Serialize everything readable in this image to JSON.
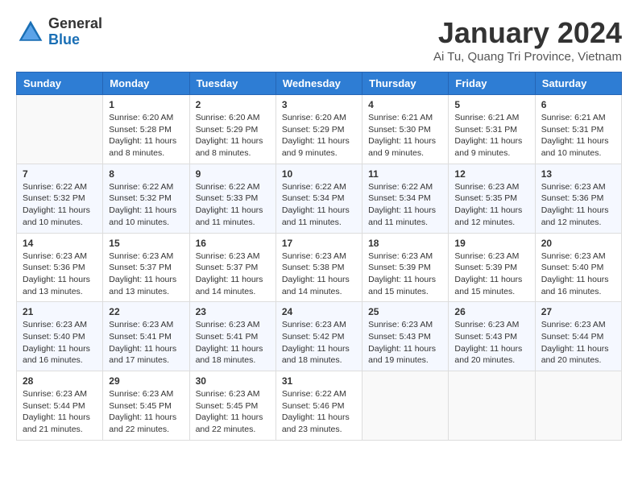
{
  "header": {
    "logo_general": "General",
    "logo_blue": "Blue",
    "month_title": "January 2024",
    "location": "Ai Tu, Quang Tri Province, Vietnam"
  },
  "calendar": {
    "days_of_week": [
      "Sunday",
      "Monday",
      "Tuesday",
      "Wednesday",
      "Thursday",
      "Friday",
      "Saturday"
    ],
    "weeks": [
      [
        {
          "day": "",
          "detail": ""
        },
        {
          "day": "1",
          "detail": "Sunrise: 6:20 AM\nSunset: 5:28 PM\nDaylight: 11 hours\nand 8 minutes."
        },
        {
          "day": "2",
          "detail": "Sunrise: 6:20 AM\nSunset: 5:29 PM\nDaylight: 11 hours\nand 8 minutes."
        },
        {
          "day": "3",
          "detail": "Sunrise: 6:20 AM\nSunset: 5:29 PM\nDaylight: 11 hours\nand 9 minutes."
        },
        {
          "day": "4",
          "detail": "Sunrise: 6:21 AM\nSunset: 5:30 PM\nDaylight: 11 hours\nand 9 minutes."
        },
        {
          "day": "5",
          "detail": "Sunrise: 6:21 AM\nSunset: 5:31 PM\nDaylight: 11 hours\nand 9 minutes."
        },
        {
          "day": "6",
          "detail": "Sunrise: 6:21 AM\nSunset: 5:31 PM\nDaylight: 11 hours\nand 10 minutes."
        }
      ],
      [
        {
          "day": "7",
          "detail": "Sunrise: 6:22 AM\nSunset: 5:32 PM\nDaylight: 11 hours\nand 10 minutes."
        },
        {
          "day": "8",
          "detail": "Sunrise: 6:22 AM\nSunset: 5:32 PM\nDaylight: 11 hours\nand 10 minutes."
        },
        {
          "day": "9",
          "detail": "Sunrise: 6:22 AM\nSunset: 5:33 PM\nDaylight: 11 hours\nand 11 minutes."
        },
        {
          "day": "10",
          "detail": "Sunrise: 6:22 AM\nSunset: 5:34 PM\nDaylight: 11 hours\nand 11 minutes."
        },
        {
          "day": "11",
          "detail": "Sunrise: 6:22 AM\nSunset: 5:34 PM\nDaylight: 11 hours\nand 11 minutes."
        },
        {
          "day": "12",
          "detail": "Sunrise: 6:23 AM\nSunset: 5:35 PM\nDaylight: 11 hours\nand 12 minutes."
        },
        {
          "day": "13",
          "detail": "Sunrise: 6:23 AM\nSunset: 5:36 PM\nDaylight: 11 hours\nand 12 minutes."
        }
      ],
      [
        {
          "day": "14",
          "detail": "Sunrise: 6:23 AM\nSunset: 5:36 PM\nDaylight: 11 hours\nand 13 minutes."
        },
        {
          "day": "15",
          "detail": "Sunrise: 6:23 AM\nSunset: 5:37 PM\nDaylight: 11 hours\nand 13 minutes."
        },
        {
          "day": "16",
          "detail": "Sunrise: 6:23 AM\nSunset: 5:37 PM\nDaylight: 11 hours\nand 14 minutes."
        },
        {
          "day": "17",
          "detail": "Sunrise: 6:23 AM\nSunset: 5:38 PM\nDaylight: 11 hours\nand 14 minutes."
        },
        {
          "day": "18",
          "detail": "Sunrise: 6:23 AM\nSunset: 5:39 PM\nDaylight: 11 hours\nand 15 minutes."
        },
        {
          "day": "19",
          "detail": "Sunrise: 6:23 AM\nSunset: 5:39 PM\nDaylight: 11 hours\nand 15 minutes."
        },
        {
          "day": "20",
          "detail": "Sunrise: 6:23 AM\nSunset: 5:40 PM\nDaylight: 11 hours\nand 16 minutes."
        }
      ],
      [
        {
          "day": "21",
          "detail": "Sunrise: 6:23 AM\nSunset: 5:40 PM\nDaylight: 11 hours\nand 16 minutes."
        },
        {
          "day": "22",
          "detail": "Sunrise: 6:23 AM\nSunset: 5:41 PM\nDaylight: 11 hours\nand 17 minutes."
        },
        {
          "day": "23",
          "detail": "Sunrise: 6:23 AM\nSunset: 5:41 PM\nDaylight: 11 hours\nand 18 minutes."
        },
        {
          "day": "24",
          "detail": "Sunrise: 6:23 AM\nSunset: 5:42 PM\nDaylight: 11 hours\nand 18 minutes."
        },
        {
          "day": "25",
          "detail": "Sunrise: 6:23 AM\nSunset: 5:43 PM\nDaylight: 11 hours\nand 19 minutes."
        },
        {
          "day": "26",
          "detail": "Sunrise: 6:23 AM\nSunset: 5:43 PM\nDaylight: 11 hours\nand 20 minutes."
        },
        {
          "day": "27",
          "detail": "Sunrise: 6:23 AM\nSunset: 5:44 PM\nDaylight: 11 hours\nand 20 minutes."
        }
      ],
      [
        {
          "day": "28",
          "detail": "Sunrise: 6:23 AM\nSunset: 5:44 PM\nDaylight: 11 hours\nand 21 minutes."
        },
        {
          "day": "29",
          "detail": "Sunrise: 6:23 AM\nSunset: 5:45 PM\nDaylight: 11 hours\nand 22 minutes."
        },
        {
          "day": "30",
          "detail": "Sunrise: 6:23 AM\nSunset: 5:45 PM\nDaylight: 11 hours\nand 22 minutes."
        },
        {
          "day": "31",
          "detail": "Sunrise: 6:22 AM\nSunset: 5:46 PM\nDaylight: 11 hours\nand 23 minutes."
        },
        {
          "day": "",
          "detail": ""
        },
        {
          "day": "",
          "detail": ""
        },
        {
          "day": "",
          "detail": ""
        }
      ]
    ]
  }
}
